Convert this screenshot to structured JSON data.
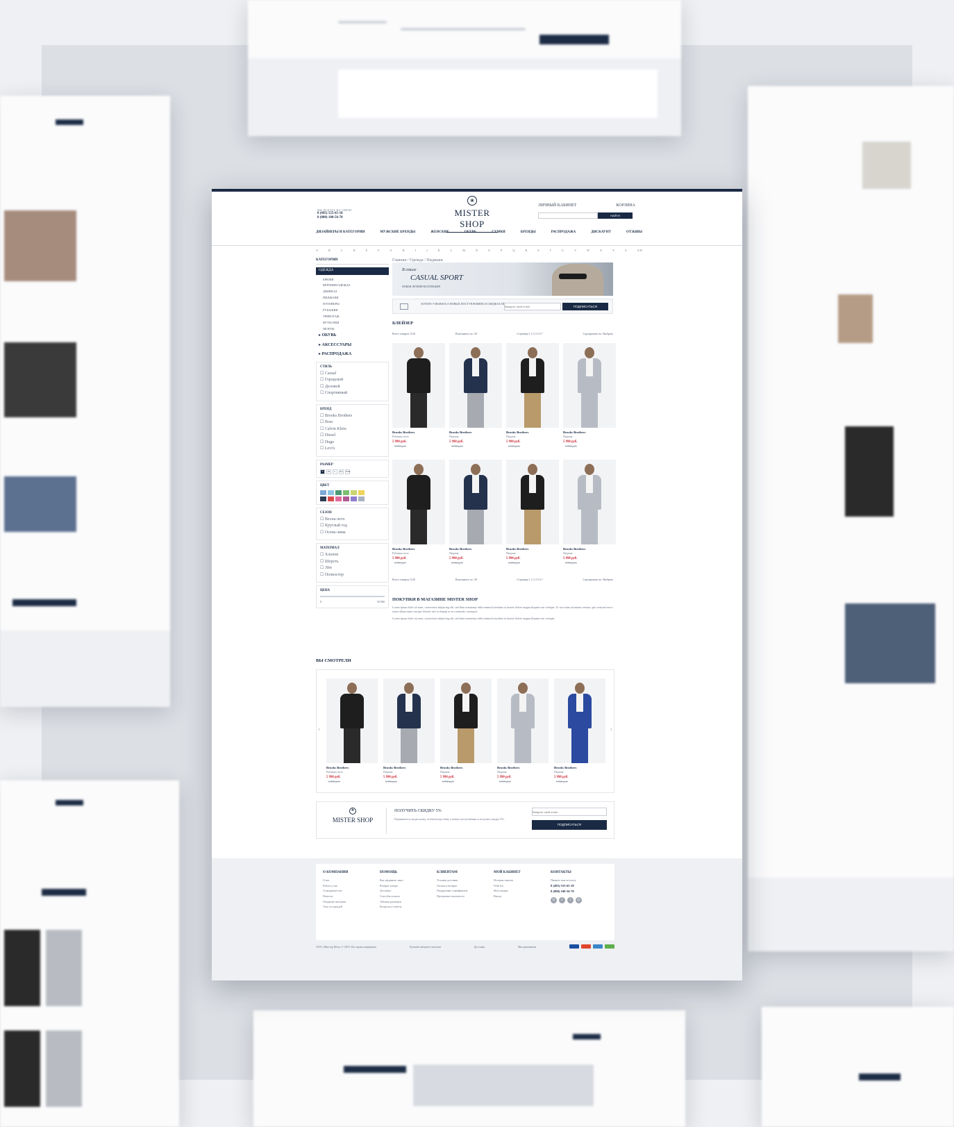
{
  "header": {
    "contacts_label": "МЫ ВСЕГДА НА СВЯЗИ",
    "phones": [
      "8 (495) 555-65-18",
      "8 (800) 100-56-78"
    ],
    "logo_icon": "shield-logo-icon",
    "logo_text": "MISTER SHOP",
    "account_links": [
      "ЛИЧНЫЙ КАБИНЕТ",
      "КОРЗИНА"
    ],
    "search_placeholder": "",
    "search_button": "НАЙТИ"
  },
  "nav": {
    "items": [
      "ДИЗАЙНЕРЫ И КАТЕГОРИИ",
      "МУЖСКИЕ БРЕНДЫ",
      "ЖЕНСКИЕ",
      "ОБУВЬ",
      "СУМКИ",
      "БРЕНДЫ",
      "РАСПРОДАЖА",
      "ДИСКАУНТ",
      "ОТЗЫВЫ"
    ]
  },
  "alphabet": [
    "A",
    "B",
    "C",
    "D",
    "E",
    "F",
    "G",
    "H",
    "I",
    "J",
    "K",
    "L",
    "M",
    "N",
    "O",
    "P",
    "Q",
    "R",
    "S",
    "T",
    "U",
    "V",
    "W",
    "X",
    "Y",
    "Z",
    "А-Я"
  ],
  "sidebar": {
    "title": "КАТЕГОРИИ",
    "active": "ОДЕЖДА",
    "subitems": [
      "БРЮКИ",
      "ВЕРХНЯЯ ОДЕЖДА",
      "ДЖИНСЫ",
      "ПИДЖАКИ",
      "ПУЛОВЕРЫ",
      "РУБАШКИ",
      "ТРИКОТАЖ",
      "ФУТБОЛКИ",
      "ШОРТЫ"
    ],
    "groups": [
      "ОБУВЬ",
      "АКСЕССУАРЫ",
      "РАСПРОДАЖА"
    ],
    "filters": [
      {
        "title": "СТИЛЬ",
        "options": [
          "Casual",
          "Городской",
          "Деловой",
          "Спортивный"
        ]
      },
      {
        "title": "БРЕНД",
        "options": [
          "Brooks Brothers",
          "Boss",
          "Calvin Klein",
          "Diesel",
          "Hugo",
          "Levi's"
        ]
      },
      {
        "title": "РАЗМЕР",
        "options": [
          "S",
          "M",
          "L",
          "XL",
          "XXL"
        ]
      },
      {
        "title": "ЦВЕТ",
        "options": []
      },
      {
        "title": "СЕЗОН",
        "options": [
          "Весна-лето",
          "Круглый год",
          "Осень-зима"
        ]
      },
      {
        "title": "МАТЕРИАЛ",
        "options": [
          "Хлопок",
          "Шерсть",
          "Лён",
          "Полиэстер"
        ]
      },
      {
        "title": "ЦЕНА",
        "options": [
          "0",
          "50 000"
        ]
      }
    ],
    "colors": [
      "#7ea9d8",
      "#8ec5e3",
      "#4c9a74",
      "#7cc06f",
      "#c9d470",
      "#f0d35a",
      "#2c3e55",
      "#d94b4b",
      "#e06a9a",
      "#b05a94",
      "#8d7ccf",
      "#a9b3c0"
    ]
  },
  "breadcrumb": "Главная / Одежда / Пиджаки",
  "banner": {
    "line1": "В стиле",
    "line2": "CASUAL SPORT",
    "line3": "НОВАЯ ЛЕТНЯЯ КОЛЛЕКЦИЯ"
  },
  "subscribe": {
    "text": "ХОТИТЕ УЗНАВАТЬ О НОВЫХ ПОСТУПЛЕНИЯХ И СКИДКАХ ПЕРВЫМ?",
    "placeholder": "Введите свой email",
    "button": "ПОДПИСАТЬСЯ"
  },
  "section_title": "БЛЕЙЗЕР",
  "sortbar": {
    "count": "Всего товаров 1120",
    "show": "Показывать по: 30",
    "pages": "Страница 1 2 3 4 5 6 7",
    "sort": "Сортировать по: Выбрать"
  },
  "products": [
    {
      "brand": "Brooks Brothers",
      "type": "Рубашка поло",
      "price": "5 990 руб.",
      "old": "6 990 руб."
    },
    {
      "brand": "Brooks Brothers",
      "type": "Пиджак",
      "price": "5 990 руб.",
      "old": "6 990 руб."
    },
    {
      "brand": "Brooks Brothers",
      "type": "Пиджак",
      "price": "5 990 руб.",
      "old": "6 990 руб."
    },
    {
      "brand": "Brooks Brothers",
      "type": "Пиджак",
      "price": "5 990 руб.",
      "old": "6 990 руб."
    },
    {
      "brand": "Brooks Brothers",
      "type": "Рубашка поло",
      "price": "5 990 руб.",
      "old": "6 990 руб."
    },
    {
      "brand": "Brooks Brothers",
      "type": "Пиджак",
      "price": "5 990 руб.",
      "old": "6 990 руб."
    },
    {
      "brand": "Brooks Brothers",
      "type": "Пиджак",
      "price": "5 990 руб.",
      "old": "6 990 руб."
    },
    {
      "brand": "Brooks Brothers",
      "type": "Пиджак",
      "price": "5 990 руб.",
      "old": "6 990 руб."
    }
  ],
  "seo": {
    "title": "ПОКУПКИ В МАГАЗИНЕ MISTER SHOP",
    "p1": "Lorem ipsum dolor sit amet, consectetur adipiscing elit, sed diam nonummy nibh euismod tincidunt ut laoreet dolore magna aliquam erat volutpat. Ut wisi enim ad minim veniam, quis nostrud exerci tation ullamcorper suscipit lobortis nisl ut aliquip ex ea commodo consequat.",
    "p2": "Lorem ipsum dolor sit amet, consectetur adipiscing elit, sed diam nonummy nibh euismod tincidunt ut laoreet dolore magna aliquam erat volutpat."
  },
  "viewed": {
    "title": "ВЫ СМОТРЕЛИ",
    "items": [
      {
        "brand": "Brooks Brothers",
        "type": "Рубашка поло",
        "price": "5 990 руб.",
        "old": "6 990 руб."
      },
      {
        "brand": "Brooks Brothers",
        "type": "Пиджак",
        "price": "5 990 руб.",
        "old": "6 990 руб."
      },
      {
        "brand": "Brooks Brothers",
        "type": "Пиджак",
        "price": "5 990 руб.",
        "old": "6 990 руб."
      },
      {
        "brand": "Brooks Brothers",
        "type": "Пиджак",
        "price": "5 990 руб.",
        "old": "6 990 руб."
      },
      {
        "brand": "Brooks Brothers",
        "type": "Пиджак",
        "price": "5 990 руб.",
        "old": "6 990 руб."
      }
    ]
  },
  "promo": {
    "logo": "MISTER SHOP",
    "title": "ПОЛУЧИТЬ СКИДКУ 5%",
    "text": "Подпишитесь на рассылку, чтобы всегда знать о новых поступлениях и получить скидку 5%.",
    "placeholder": "Введите свой email",
    "button": "ПОДПИСАТЬСЯ"
  },
  "footer": {
    "columns": [
      {
        "title": "О КОМПАНИИ",
        "items": [
          "О нас",
          "Работа у нас",
          "Сотрудничество",
          "Новости",
          "Открытие магазина",
          "Уход за одеждой"
        ]
      },
      {
        "title": "ПОМОЩЬ",
        "items": [
          "Как оформить заказ",
          "Возврат товара",
          "Доставка",
          "Способы оплаты",
          "Таблица размеров",
          "Вопросы и ответы"
        ]
      },
      {
        "title": "КЛИЕНТАМ",
        "items": [
          "Условия доставки",
          "Оплата и возврат",
          "Подарочные сертификаты",
          "Программа лояльности"
        ]
      },
      {
        "title": "МОЙ КАБИНЕТ",
        "items": [
          "История заказов",
          "Wish list",
          "Мои скидки",
          "Выход"
        ]
      },
      {
        "title": "КОНТАКТЫ",
        "items": [
          "Пишите нам на почту"
        ]
      }
    ],
    "phones": [
      "8 (495) 555-65-18",
      "8 (800) 100-56-78"
    ],
    "social_icons": [
      "vk-icon",
      "facebook-icon",
      "twitter-icon",
      "instagram-icon"
    ],
    "copyright": "ООО «Мистер Шоп» © 2015. Все права защищены",
    "award": "Лучший интернет-магазин",
    "delivery": "Доставка",
    "payment": "Мы принимаем"
  }
}
